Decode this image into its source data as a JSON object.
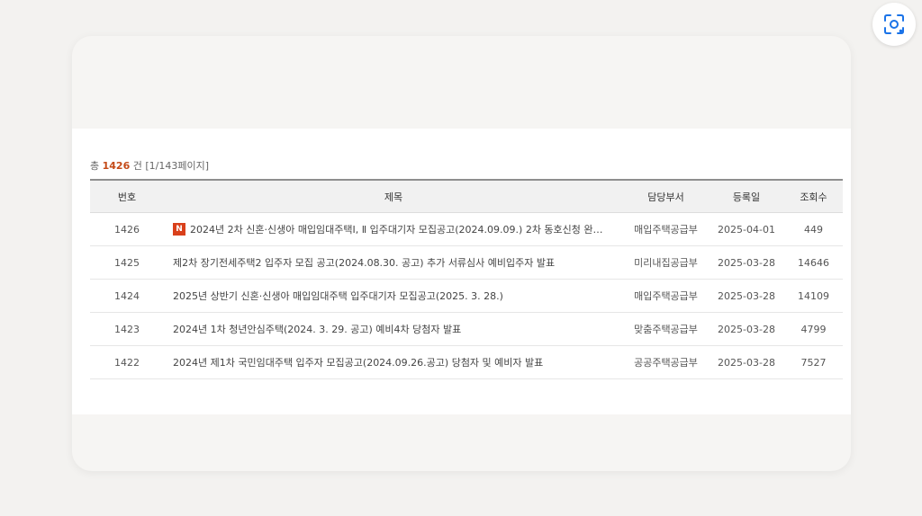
{
  "summary": {
    "prefix": "총",
    "count": "1426",
    "suffix": "건 [1/143페이지]"
  },
  "table": {
    "headers": [
      "번호",
      "제목",
      "담당부서",
      "등록일",
      "조회수"
    ],
    "rows": [
      {
        "number": "1426",
        "is_new": true,
        "new_badge": "N",
        "title": "2024년 2차 신혼·신생아 매입임대주택Ⅰ, Ⅱ 입주대기자 모집공고(2024.09.09.) 2차 동호신청 완…",
        "department": "매입주택공급부",
        "date": "2025-04-01",
        "views": "449"
      },
      {
        "number": "1425",
        "is_new": false,
        "title": "제2차 장기전세주택2 입주자 모집 공고(2024.08.30. 공고) 추가 서류심사 예비입주자 발표",
        "department": "미리내집공급부",
        "date": "2025-03-28",
        "views": "14646"
      },
      {
        "number": "1424",
        "is_new": false,
        "title": "2025년 상반기 신혼·신생아 매입임대주택 입주대기자 모집공고(2025. 3. 28.)",
        "department": "매입주택공급부",
        "date": "2025-03-28",
        "views": "14109"
      },
      {
        "number": "1423",
        "is_new": false,
        "title": "2024년 1차 청년안심주택(2024. 3. 29. 공고) 예비4차 당첨자 발표",
        "department": "맞춤주택공급부",
        "date": "2025-03-28",
        "views": "4799"
      },
      {
        "number": "1422",
        "is_new": false,
        "title": "2024년 제1차 국민임대주택 입주자 모집공고(2024.09.26.공고) 당첨자 및 예비자 발표",
        "department": "공공주택공급부",
        "date": "2025-03-28",
        "views": "7527"
      }
    ]
  },
  "overlay_button": {
    "icon": "lens-icon"
  },
  "colors": {
    "accent": "#c44a17",
    "new_badge": "#d9401b",
    "lens_icon": "#1a73e8"
  }
}
